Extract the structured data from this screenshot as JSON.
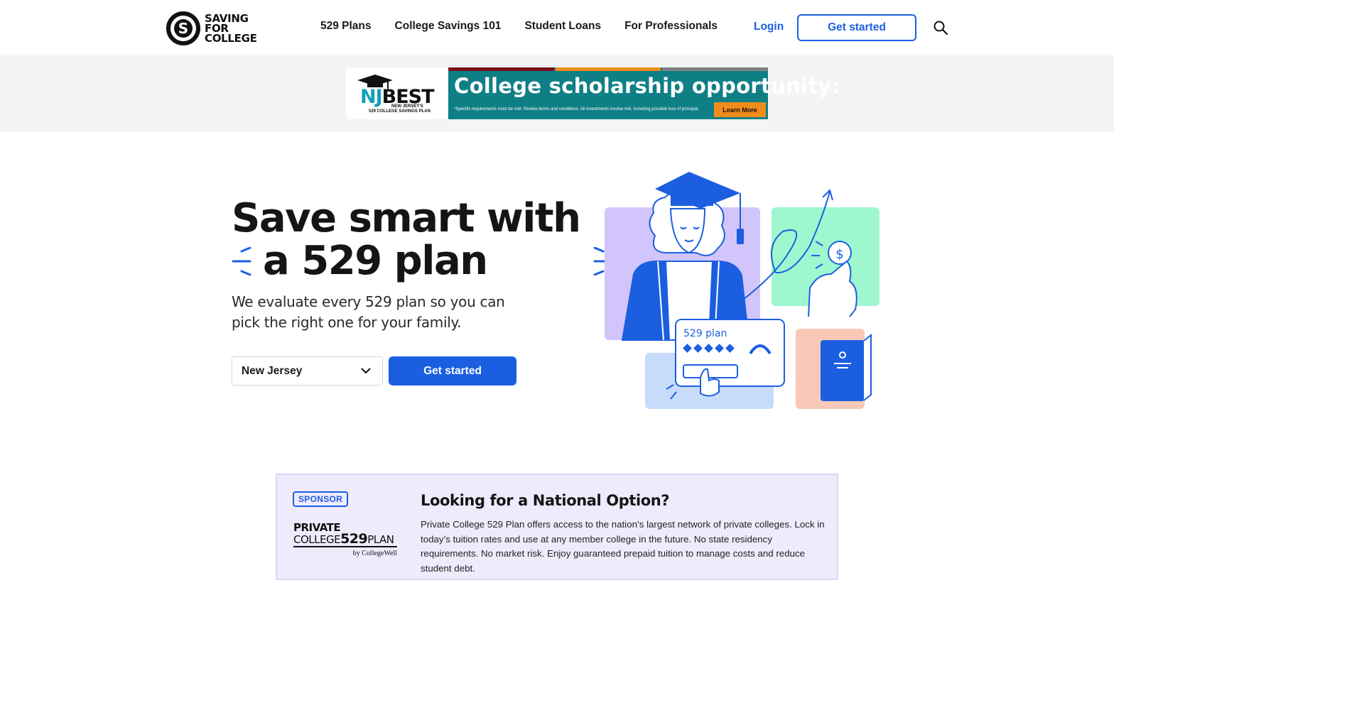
{
  "header": {
    "logo": {
      "name": "Saving for College",
      "lines": [
        "SAVING",
        "FOR",
        "COLLEGE"
      ]
    },
    "nav": [
      "529 Plans",
      "College Savings 101",
      "Student Loans",
      "For Professionals"
    ],
    "login_label": "Login",
    "get_started_label": "Get started",
    "search_icon": "search-icon"
  },
  "ad": {
    "logo_text": "NJBEST",
    "logo_sub1": "NEW JERSEY'S",
    "logo_sub2": "529 COLLEGE SAVINGS PLAN",
    "headline": "College scholarship opportunity:",
    "fine_print": "*Specific requirements must be met. Review terms and conditions. All investments involve risk, including possible loss of principal.",
    "cta_label": "Learn More",
    "colors": {
      "teal": "#0f7f86",
      "stripe1": "#7a1020",
      "stripe2": "#f08c1a",
      "stripe3": "#808080",
      "cta": "#f08c1a"
    }
  },
  "hero": {
    "title_line1": "Save smart with",
    "title_line2": "a 529 plan",
    "subtitle": "We evaluate every 529 plan so you can pick the right one for your family.",
    "state_selected": "New Jersey",
    "cta_label": "Get started",
    "illustration": {
      "card_label": "529 plan"
    }
  },
  "sponsor": {
    "badge": "SPONSOR",
    "logo_line1": "PRIVATE",
    "logo_line2a": "COLLEGE",
    "logo_line2b": "529",
    "logo_line2c": "PLAN",
    "logo_line3": "by CollegeWell",
    "title": "Looking for a National Option?",
    "body": "Private College 529 Plan offers access to the nation’s largest network of private colleges. Lock in today’s tuition rates and use at any member college in the future. No state residency requirements. No market risk. Enjoy guaranteed prepaid tuition to manage costs and reduce student debt."
  },
  "colors": {
    "brand_blue": "#1b5fe0",
    "text": "#151515",
    "ad_band": "#f4f4f4",
    "sponsor_bg": "#efebfd"
  }
}
